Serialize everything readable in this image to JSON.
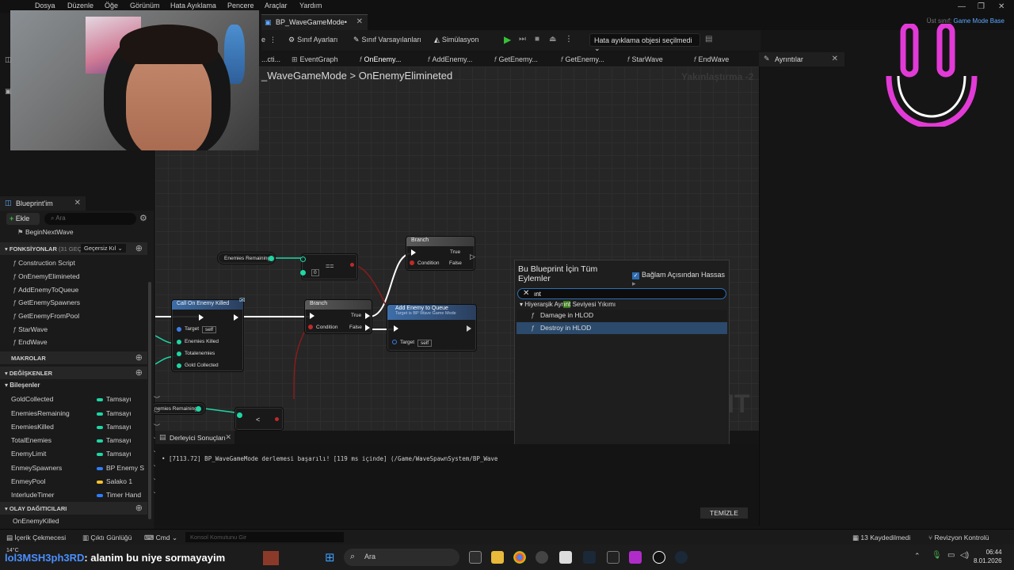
{
  "menu": [
    "Dosya",
    "Düzenle",
    "Öğe",
    "Görünüm",
    "Hata Ayıklama",
    "Pencere",
    "Araçlar",
    "Yardım"
  ],
  "document_tab": "BP_WaveGameMode•",
  "parent_class": {
    "label": "Üst sınıf:",
    "value": "Game Mode Base"
  },
  "toolbar": {
    "class_settings": "Sınıf Ayarları",
    "class_defaults": "Sınıf Varsayılanları",
    "simulation": "Simülasyon",
    "debug_object": "Hata ayıklama objesi seçilmedi"
  },
  "graph_tabs": [
    "...cti...",
    "EventGraph",
    "OnEnemy...",
    "AddEnemy...",
    "GetEnemy...",
    "GetEnemy...",
    "StarWave",
    "EndWave"
  ],
  "details_tab": "Ayrıntılar",
  "breadcrumb": {
    "parent": "_WaveGameMode",
    "separator": ">",
    "current": "OnEnemyElimineted"
  },
  "zoom_label": "Yakınlaştırma -2",
  "blueprint_panel": {
    "tab": "Blueprint'im",
    "add_label": "Ekle",
    "search_placeholder": "Ara",
    "top_item": "BeginNextWave",
    "functions_header": "FONKSİYONLAR",
    "functions_count": "(31 GEÇE",
    "override_label": "Geçersiz Kıl",
    "functions": [
      "Construction Script",
      "OnEnemyElimineted",
      "AddEnemyToQueue",
      "GetEnemySpawners",
      "GetEnemyFromPool",
      "StarWave",
      "EndWave"
    ],
    "macros_header": "MAKROLAR",
    "variables_header": "DEĞİŞKENLER",
    "components_label": "Bileşenler",
    "variables": [
      {
        "name": "GoldCollected",
        "type": "Tamsayı",
        "color": "#1fd6a4"
      },
      {
        "name": "EnemiesRemaining",
        "type": "Tamsayı",
        "color": "#1fd6a4"
      },
      {
        "name": "EnemiesKilled",
        "type": "Tamsayı",
        "color": "#1fd6a4"
      },
      {
        "name": "TotalEnemies",
        "type": "Tamsayı",
        "color": "#1fd6a4"
      },
      {
        "name": "EnemyLimit",
        "type": "Tamsayı",
        "color": "#1fd6a4"
      },
      {
        "name": "EnmeySpawners",
        "type": "BP Enemy S",
        "color": "#2f7dff"
      },
      {
        "name": "EnmeyPool",
        "type": "Salako 1",
        "color": "#f2c230"
      },
      {
        "name": "InterludeTimer",
        "type": "Timer Hand",
        "color": "#2f7dff"
      }
    ],
    "dispatchers_header": "OLAY DAĞITICILARI",
    "dispatcher_item": "OnEnemyKilled"
  },
  "nodes": {
    "branch_top": {
      "title": "Branch",
      "true": "True",
      "false": "False",
      "condition": "Condition"
    },
    "enemies_remaining_getter": "Enemies Remaining",
    "equals_op": "==",
    "equals_input": "0",
    "call_on_enemy_killed": {
      "title": "Call On Enemy Killed",
      "target": "Target",
      "self": "self",
      "pins": [
        "Enemies Killed",
        "Totalenemies",
        "Gold Collected"
      ]
    },
    "branch_mid": {
      "title": "Branch",
      "true": "True",
      "false": "False",
      "condition": "Condition"
    },
    "add_enemy_to_queue": {
      "title": "Add Enemy to Queue",
      "subtitle": "Target is BP Wave Game Mode",
      "target": "Target",
      "self": "self"
    },
    "enemies_remaining_bottom": "nemies Remaining",
    "less_op": "<"
  },
  "action_menu": {
    "title": "Bu Blueprint İçin Tüm Eylemler",
    "context_label": "Bağlam Açısından Hassas",
    "search_value": "ınt",
    "category_prefix": "Hiyerarşik Ayr",
    "category_highlight": "ınt",
    "category_suffix": " Seviyesi Yıkımı",
    "items": [
      "Damage in HLOD",
      "Destroy in HLOD"
    ]
  },
  "compiler": {
    "tab": "Derleyici Sonuçları",
    "message": "[7113.72] BP_WaveGameMode derlemesi başarılı! [119 ms içinde] (/Game/WaveSpawnSystem/BP_Wave",
    "clear_label": "TEMİZLE"
  },
  "statusbar": {
    "content_drawer": "İçerik Çekmecesi",
    "output_log": "Çıktı Günlüğü",
    "cmd": "Cmd",
    "console_placeholder": "Konsol Komutunu Gir",
    "saved": "13 Kaydedilmedi",
    "revision": "Revizyon Kontrolü"
  },
  "taskbar": {
    "chat_user": "lol3MSH3ph3RD",
    "chat_message": ": alanim bu niye sormayayim",
    "weather": "14°C",
    "search_label": "Ara",
    "time": "06:44",
    "date": "8.01.2026"
  },
  "colors": {
    "accent": "#2f6fb5",
    "play": "#35c235",
    "logo": "#e23ad6"
  }
}
